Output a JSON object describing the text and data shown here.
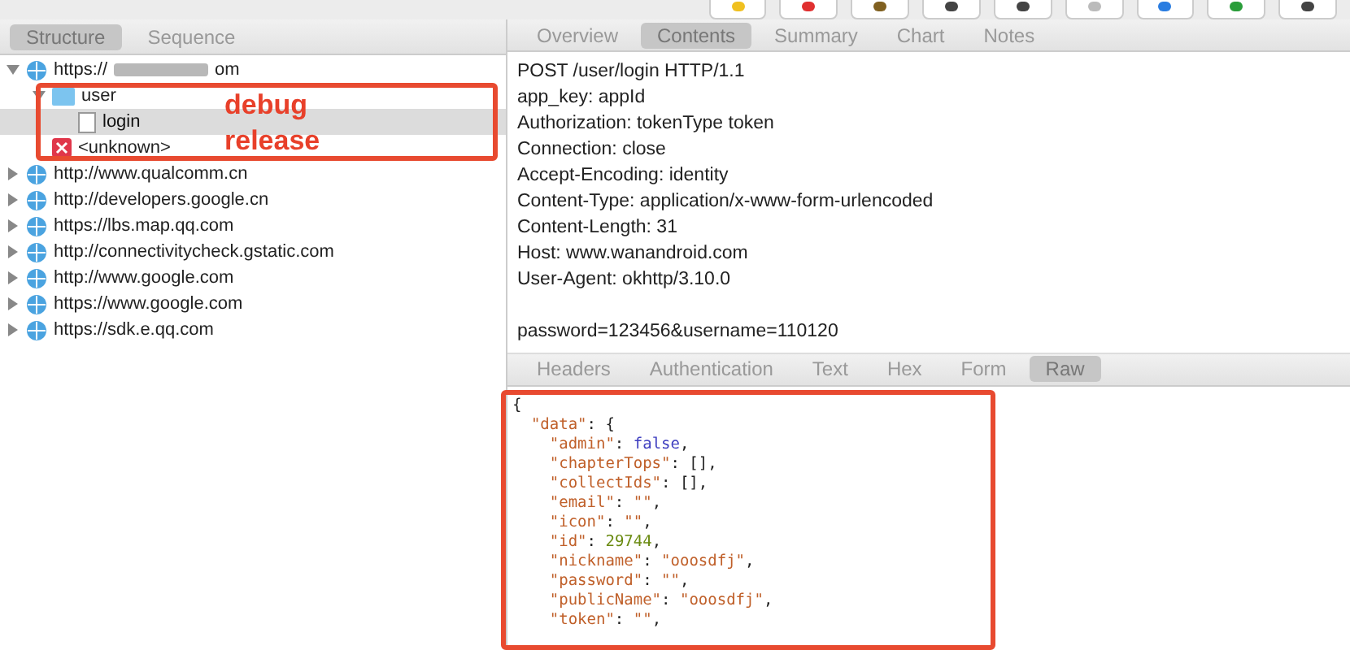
{
  "left_tabs": [
    {
      "label": "Structure",
      "selected": true
    },
    {
      "label": "Sequence",
      "selected": false
    }
  ],
  "tree": [
    {
      "kind": "host",
      "prefix": "https://",
      "suffix": "om",
      "expanded": true,
      "children": [
        {
          "kind": "folder",
          "label": "user",
          "expanded": true,
          "children": [
            {
              "kind": "file",
              "label": "login",
              "selected": true
            }
          ]
        },
        {
          "kind": "error",
          "label": "<unknown>",
          "selected": false
        }
      ]
    },
    {
      "kind": "host",
      "label": "http://www.qualcomm.cn",
      "expanded": false
    },
    {
      "kind": "host",
      "label": "http://developers.google.cn",
      "expanded": false
    },
    {
      "kind": "host",
      "label": "https://lbs.map.qq.com",
      "expanded": false
    },
    {
      "kind": "host",
      "label": "http://connectivitycheck.gstatic.com",
      "expanded": false
    },
    {
      "kind": "host",
      "label": "http://www.google.com",
      "expanded": false
    },
    {
      "kind": "host",
      "label": "https://www.google.com",
      "expanded": false
    },
    {
      "kind": "host",
      "label": "https://sdk.e.qq.com",
      "expanded": false
    }
  ],
  "annotation_labels": [
    "debug",
    "release"
  ],
  "top_tabs": [
    {
      "label": "Overview",
      "selected": false
    },
    {
      "label": "Contents",
      "selected": true
    },
    {
      "label": "Summary",
      "selected": false
    },
    {
      "label": "Chart",
      "selected": false
    },
    {
      "label": "Notes",
      "selected": false
    }
  ],
  "request_headers": [
    "POST /user/login HTTP/1.1",
    "app_key: appId",
    "Authorization: tokenType token",
    "Connection: close",
    "Accept-Encoding: identity",
    "Content-Type: application/x-www-form-urlencoded",
    "Content-Length: 31",
    "Host: www.wanandroid.com",
    "User-Agent: okhttp/3.10.0"
  ],
  "request_body": "password=123456&username=110120",
  "bottom_tabs": [
    {
      "label": "Headers",
      "selected": false
    },
    {
      "label": "Authentication",
      "selected": false
    },
    {
      "label": "Text",
      "selected": false
    },
    {
      "label": "Hex",
      "selected": false
    },
    {
      "label": "Form",
      "selected": false
    },
    {
      "label": "Raw",
      "selected": true
    }
  ],
  "json_lines": [
    [
      {
        "kind": "punct",
        "text": "{"
      }
    ],
    [
      {
        "kind": "key",
        "text": "  \"data\""
      },
      {
        "kind": "punct",
        "text": ": {"
      }
    ],
    [
      {
        "kind": "key",
        "text": "    \"admin\""
      },
      {
        "kind": "punct",
        "text": ": "
      },
      {
        "kind": "bool",
        "text": "false"
      },
      {
        "kind": "punct",
        "text": ","
      }
    ],
    [
      {
        "kind": "key",
        "text": "    \"chapterTops\""
      },
      {
        "kind": "punct",
        "text": ": [],"
      }
    ],
    [
      {
        "kind": "key",
        "text": "    \"collectIds\""
      },
      {
        "kind": "punct",
        "text": ": [],"
      }
    ],
    [
      {
        "kind": "key",
        "text": "    \"email\""
      },
      {
        "kind": "punct",
        "text": ": "
      },
      {
        "kind": "string",
        "text": "\"\""
      },
      {
        "kind": "punct",
        "text": ","
      }
    ],
    [
      {
        "kind": "key",
        "text": "    \"icon\""
      },
      {
        "kind": "punct",
        "text": ": "
      },
      {
        "kind": "string",
        "text": "\"\""
      },
      {
        "kind": "punct",
        "text": ","
      }
    ],
    [
      {
        "kind": "key",
        "text": "    \"id\""
      },
      {
        "kind": "punct",
        "text": ": "
      },
      {
        "kind": "number",
        "text": "29744"
      },
      {
        "kind": "punct",
        "text": ","
      }
    ],
    [
      {
        "kind": "key",
        "text": "    \"nickname\""
      },
      {
        "kind": "punct",
        "text": ": "
      },
      {
        "kind": "string",
        "text": "\"ooosdfj\""
      },
      {
        "kind": "punct",
        "text": ","
      }
    ],
    [
      {
        "kind": "key",
        "text": "    \"password\""
      },
      {
        "kind": "punct",
        "text": ": "
      },
      {
        "kind": "string",
        "text": "\"\""
      },
      {
        "kind": "punct",
        "text": ","
      }
    ],
    [
      {
        "kind": "key",
        "text": "    \"publicName\""
      },
      {
        "kind": "punct",
        "text": ": "
      },
      {
        "kind": "string",
        "text": "\"ooosdfj\""
      },
      {
        "kind": "punct",
        "text": ","
      }
    ],
    [
      {
        "kind": "key",
        "text": "    \"token\""
      },
      {
        "kind": "punct",
        "text": ": "
      },
      {
        "kind": "string",
        "text": "\"\""
      },
      {
        "kind": "punct",
        "text": ","
      }
    ]
  ]
}
